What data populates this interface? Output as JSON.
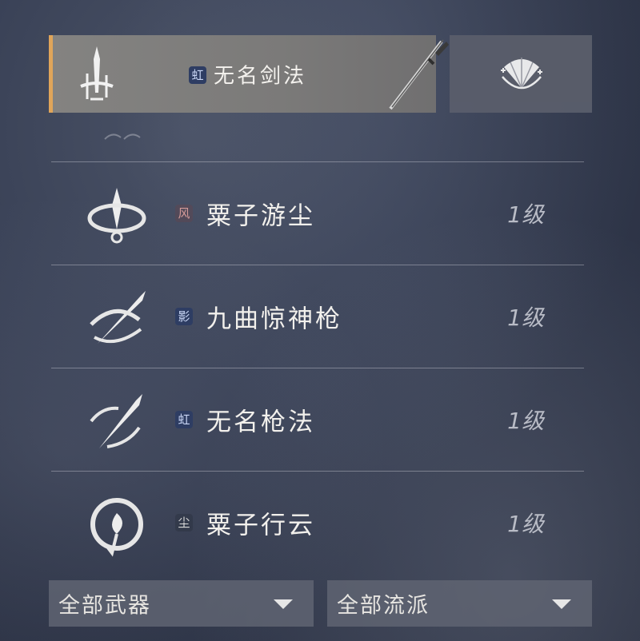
{
  "equipped": {
    "school": "虹",
    "school_style": "blue",
    "skill_name": "无名剑法",
    "weapon_icon": "sword-emblem-icon",
    "weapon_image": "long-sword-icon",
    "accent_color": "#e0a55a"
  },
  "side_slot": {
    "icon": "fan-icon"
  },
  "skills": [
    {
      "icon": "spinning-blade-icon",
      "school": "风",
      "school_style": "red",
      "name": "粟子游尘",
      "level": "1级"
    },
    {
      "icon": "spear-swirl-icon",
      "school": "影",
      "school_style": "blue",
      "name": "九曲惊神枪",
      "level": "1级"
    },
    {
      "icon": "spear-slash-icon",
      "school": "虹",
      "school_style": "blue",
      "name": "无名枪法",
      "level": "1级"
    },
    {
      "icon": "cloud-spiral-icon",
      "school": "尘",
      "school_style": "gray",
      "name": "粟子行云",
      "level": "1级"
    }
  ],
  "filters": {
    "weapon": "全部武器",
    "school": "全部流派"
  }
}
